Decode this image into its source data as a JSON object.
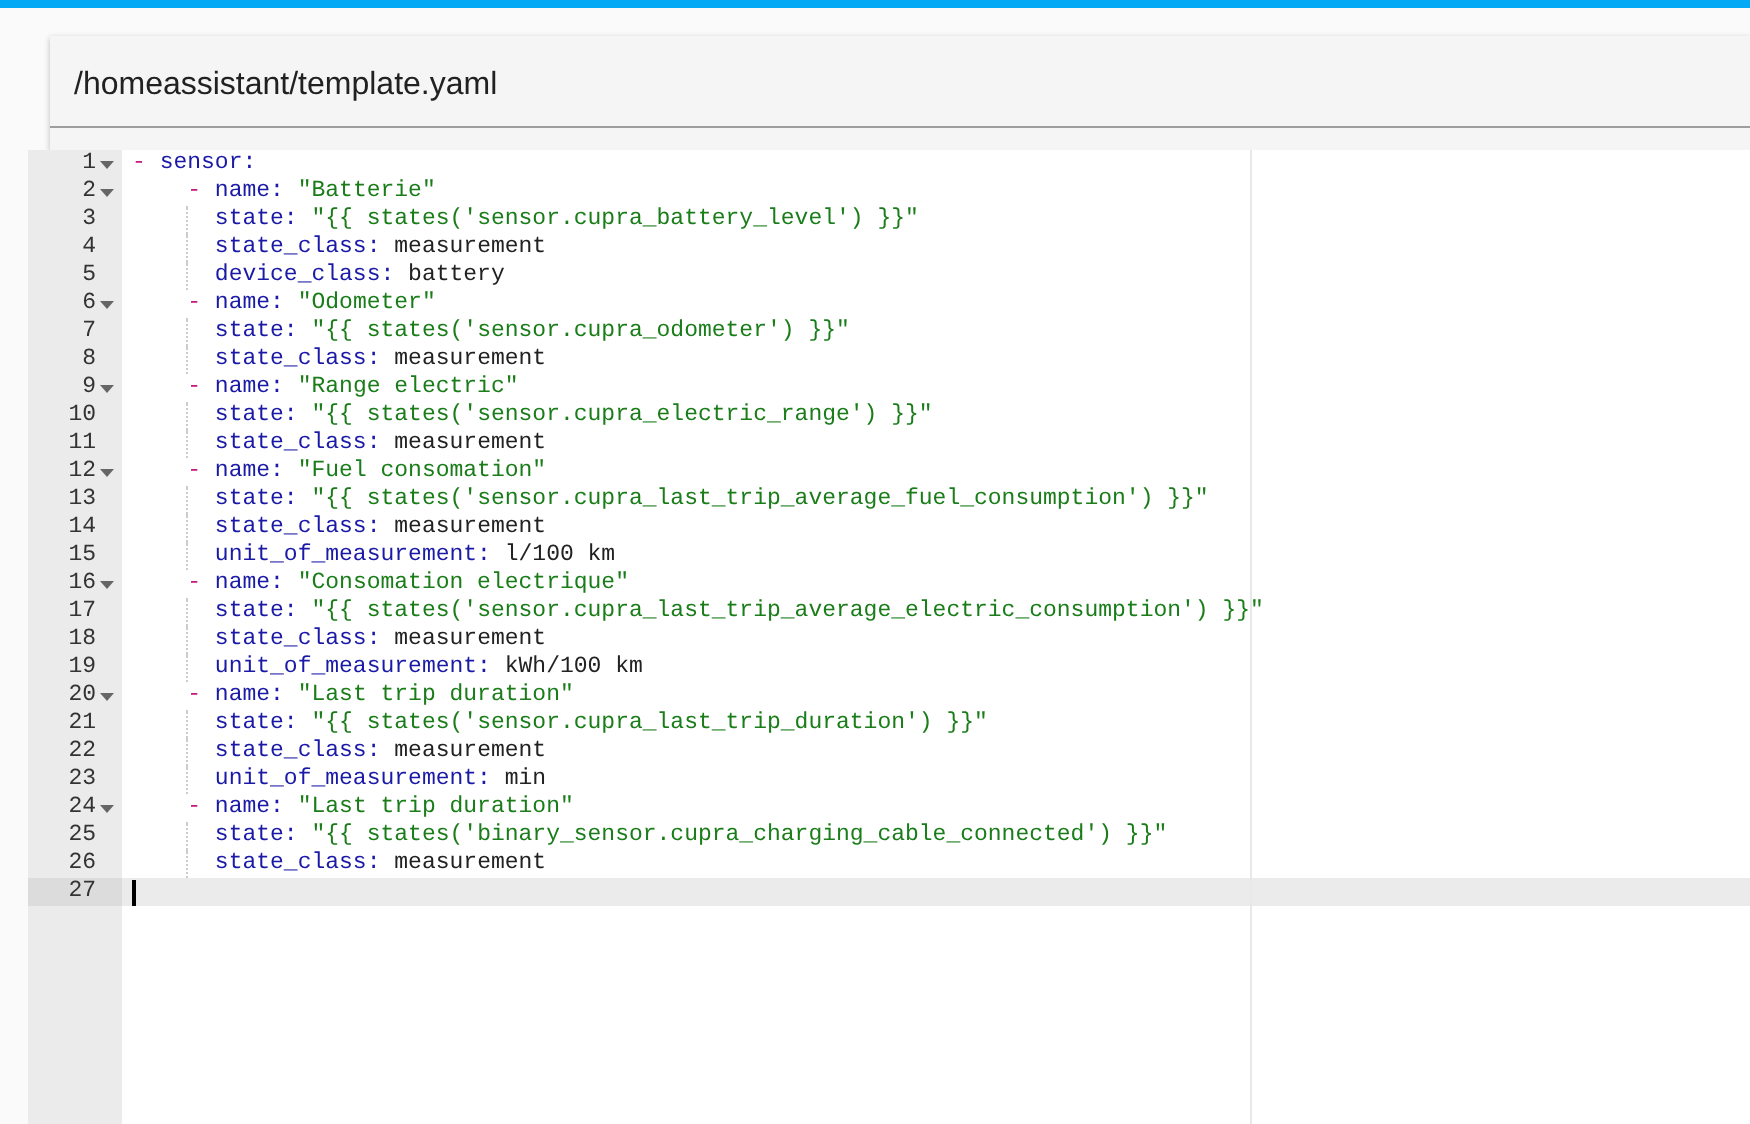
{
  "file_path": "/homeassistant/template.yaml",
  "editor": {
    "lines": [
      {
        "number": "1",
        "fold": true,
        "active": false,
        "text": "- sensor:"
      },
      {
        "number": "2",
        "fold": true,
        "active": false,
        "text": "    - name: \"Batterie\""
      },
      {
        "number": "3",
        "fold": false,
        "active": false,
        "text": "      state: \"{{ states('sensor.cupra_battery_level') }}\""
      },
      {
        "number": "4",
        "fold": false,
        "active": false,
        "text": "      state_class: measurement"
      },
      {
        "number": "5",
        "fold": false,
        "active": false,
        "text": "      device_class: battery"
      },
      {
        "number": "6",
        "fold": true,
        "active": false,
        "text": "    - name: \"Odometer\""
      },
      {
        "number": "7",
        "fold": false,
        "active": false,
        "text": "      state: \"{{ states('sensor.cupra_odometer') }}\""
      },
      {
        "number": "8",
        "fold": false,
        "active": false,
        "text": "      state_class: measurement"
      },
      {
        "number": "9",
        "fold": true,
        "active": false,
        "text": "    - name: \"Range electric\""
      },
      {
        "number": "10",
        "fold": false,
        "active": false,
        "text": "      state: \"{{ states('sensor.cupra_electric_range') }}\""
      },
      {
        "number": "11",
        "fold": false,
        "active": false,
        "text": "      state_class: measurement"
      },
      {
        "number": "12",
        "fold": true,
        "active": false,
        "text": "    - name: \"Fuel consomation\""
      },
      {
        "number": "13",
        "fold": false,
        "active": false,
        "text": "      state: \"{{ states('sensor.cupra_last_trip_average_fuel_consumption') }}\""
      },
      {
        "number": "14",
        "fold": false,
        "active": false,
        "text": "      state_class: measurement"
      },
      {
        "number": "15",
        "fold": false,
        "active": false,
        "text": "      unit_of_measurement: l/100 km"
      },
      {
        "number": "16",
        "fold": true,
        "active": false,
        "text": "    - name: \"Consomation electrique\""
      },
      {
        "number": "17",
        "fold": false,
        "active": false,
        "text": "      state: \"{{ states('sensor.cupra_last_trip_average_electric_consumption') }}\""
      },
      {
        "number": "18",
        "fold": false,
        "active": false,
        "text": "      state_class: measurement"
      },
      {
        "number": "19",
        "fold": false,
        "active": false,
        "text": "      unit_of_measurement: kWh/100 km"
      },
      {
        "number": "20",
        "fold": true,
        "active": false,
        "text": "    - name: \"Last trip duration\""
      },
      {
        "number": "21",
        "fold": false,
        "active": false,
        "text": "      state: \"{{ states('sensor.cupra_last_trip_duration') }}\""
      },
      {
        "number": "22",
        "fold": false,
        "active": false,
        "text": "      state_class: measurement"
      },
      {
        "number": "23",
        "fold": false,
        "active": false,
        "text": "      unit_of_measurement: min"
      },
      {
        "number": "24",
        "fold": true,
        "active": false,
        "text": "    - name: \"Last trip duration\""
      },
      {
        "number": "25",
        "fold": false,
        "active": false,
        "text": "      state: \"{{ states('binary_sensor.cupra_charging_cable_connected') }}\""
      },
      {
        "number": "26",
        "fold": false,
        "active": false,
        "text": "      state_class: measurement"
      },
      {
        "number": "27",
        "fold": false,
        "active": true
      }
    ]
  }
}
